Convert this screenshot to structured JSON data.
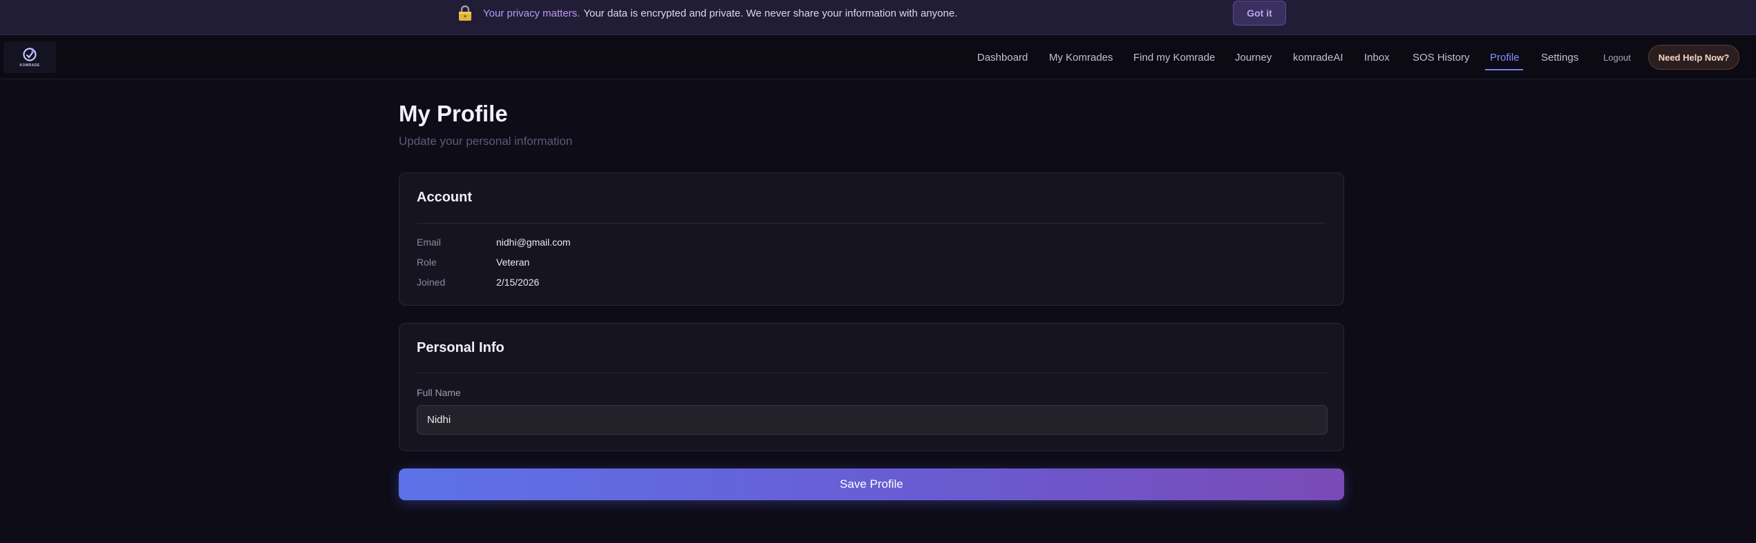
{
  "banner": {
    "icon": "lock-icon",
    "title": "Your privacy matters.",
    "text": "Your data is encrypted and private. We never share your information with anyone.",
    "dismiss_label": "Got it"
  },
  "logo": {
    "icon": "komrade-logo-icon",
    "text": "KOMRADE"
  },
  "nav": {
    "items": [
      {
        "label": "Dashboard"
      },
      {
        "label": "My Komrades"
      },
      {
        "label": "Find my Komrade"
      },
      {
        "label": "Journey"
      },
      {
        "label": "komradeAI"
      },
      {
        "label": "Inbox"
      },
      {
        "label": "SOS History"
      },
      {
        "label": "Profile",
        "active": true
      },
      {
        "label": "Settings"
      }
    ],
    "logout_label": "Logout",
    "help_label": "Need Help Now?"
  },
  "page": {
    "title": "My Profile",
    "subtitle": "Update your personal information"
  },
  "account": {
    "title": "Account",
    "rows": [
      {
        "label": "Email",
        "value": "nidhi@gmail.com"
      },
      {
        "label": "Role",
        "value": "Veteran"
      },
      {
        "label": "Joined",
        "value": "2/15/2026"
      }
    ]
  },
  "personal": {
    "title": "Personal Info",
    "full_name_label": "Full Name",
    "full_name_value": "Nidhi"
  },
  "save_label": "Save Profile",
  "colors": {
    "accent": "#7b7ef3",
    "banner_title": "#b69cf5",
    "button_gradient_start": "#5d72e8",
    "button_gradient_end": "#7a4ab6"
  }
}
